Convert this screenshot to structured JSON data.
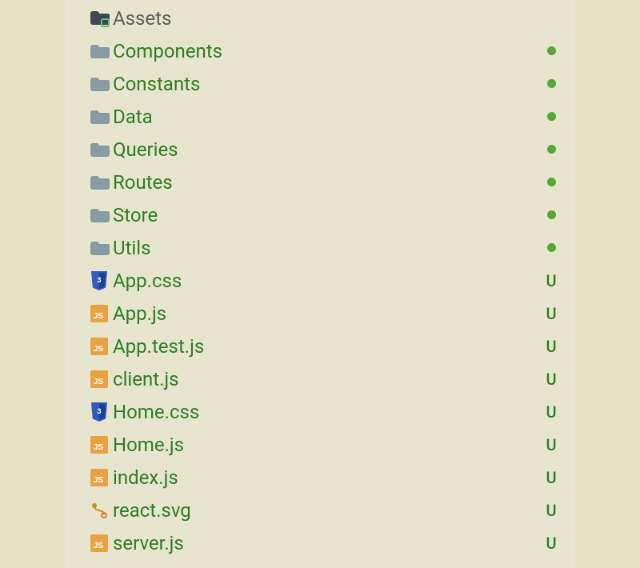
{
  "explorer": {
    "items": [
      {
        "name": "Assets",
        "icon": "folder-asset",
        "labelStyle": "muted",
        "status": "none"
      },
      {
        "name": "Components",
        "icon": "folder",
        "labelStyle": "normal",
        "status": "dot"
      },
      {
        "name": "Constants",
        "icon": "folder",
        "labelStyle": "normal",
        "status": "dot"
      },
      {
        "name": "Data",
        "icon": "folder",
        "labelStyle": "normal",
        "status": "dot"
      },
      {
        "name": "Queries",
        "icon": "folder",
        "labelStyle": "normal",
        "status": "dot"
      },
      {
        "name": "Routes",
        "icon": "folder",
        "labelStyle": "normal",
        "status": "dot"
      },
      {
        "name": "Store",
        "icon": "folder",
        "labelStyle": "normal",
        "status": "dot"
      },
      {
        "name": "Utils",
        "icon": "folder",
        "labelStyle": "normal",
        "status": "dot"
      },
      {
        "name": "App.css",
        "icon": "css",
        "labelStyle": "normal",
        "status": "U"
      },
      {
        "name": "App.js",
        "icon": "js",
        "labelStyle": "normal",
        "status": "U"
      },
      {
        "name": "App.test.js",
        "icon": "js",
        "labelStyle": "normal",
        "status": "U"
      },
      {
        "name": "client.js",
        "icon": "js",
        "labelStyle": "normal",
        "status": "U"
      },
      {
        "name": "Home.css",
        "icon": "css",
        "labelStyle": "normal",
        "status": "U"
      },
      {
        "name": "Home.js",
        "icon": "js",
        "labelStyle": "normal",
        "status": "U"
      },
      {
        "name": "index.js",
        "icon": "js",
        "labelStyle": "normal",
        "status": "U"
      },
      {
        "name": "react.svg",
        "icon": "svg",
        "labelStyle": "normal",
        "status": "U"
      },
      {
        "name": "server.js",
        "icon": "js",
        "labelStyle": "normal",
        "status": "U"
      }
    ],
    "statusChars": {
      "U": "U"
    },
    "colors": {
      "panelBg": "#e7e5ce",
      "outerBg": "#e4e2c6",
      "labelGreen": "#2e7d23",
      "labelMuted": "#5a5e57",
      "dotGreen": "#5aa53a",
      "folderFill": "#8a9aa3",
      "jsFill": "#e9a243",
      "cssFill": "#2f5dbf",
      "svgStroke": "#d18a2b",
      "assetDark": "#3a4954",
      "assetAccent": "#5fbf6a"
    }
  }
}
